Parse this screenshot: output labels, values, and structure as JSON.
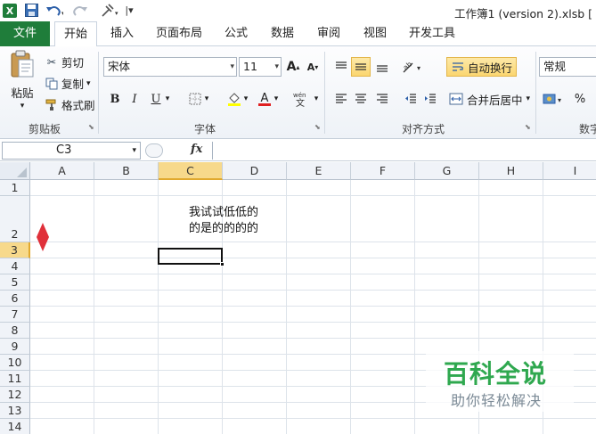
{
  "window": {
    "title": "工作簿1 (version 2).xlsb ["
  },
  "quick_access": {
    "icons": [
      "excel-icon",
      "save-icon",
      "undo-icon",
      "redo-icon",
      "customize-icon"
    ]
  },
  "tabs": [
    {
      "label": "文件"
    },
    {
      "label": "开始"
    },
    {
      "label": "插入"
    },
    {
      "label": "页面布局"
    },
    {
      "label": "公式"
    },
    {
      "label": "数据"
    },
    {
      "label": "审阅"
    },
    {
      "label": "视图"
    },
    {
      "label": "开发工具"
    }
  ],
  "ribbon": {
    "clipboard": {
      "paste": "粘贴",
      "cut": "剪切",
      "copy": "复制",
      "format_painter": "格式刷",
      "group_label": "剪贴板"
    },
    "font": {
      "font_name": "宋体",
      "font_size": "11",
      "bold": "B",
      "italic": "I",
      "underline": "U",
      "group_label": "字体"
    },
    "alignment": {
      "wrap_text": "自动换行",
      "merge_center": "合并后居中",
      "group_label": "对齐方式"
    },
    "number": {
      "format": "常规",
      "percent": "%",
      "group_label": "数字"
    }
  },
  "formula_bar": {
    "name_box": "C3",
    "fx_label": "fx",
    "formula": ""
  },
  "sheet": {
    "columns": [
      "A",
      "B",
      "C",
      "D",
      "E",
      "F",
      "G",
      "H",
      "I"
    ],
    "rows": [
      "1",
      "2",
      "3",
      "4",
      "5",
      "6",
      "7",
      "8",
      "9",
      "10",
      "11",
      "12",
      "13",
      "14"
    ],
    "selected_cell": "C3",
    "cells": {
      "C2_line1": "我试试低低的",
      "C2_line2": "的是的的的的"
    }
  },
  "watermark": {
    "title": "百科全说",
    "subtitle": "助你轻松解决"
  },
  "colors": {
    "file_tab": "#1f7d3a",
    "selection_header": "#f7d98b",
    "resize_arrow": "#e0303a",
    "watermark_green": "#2fa84f"
  }
}
